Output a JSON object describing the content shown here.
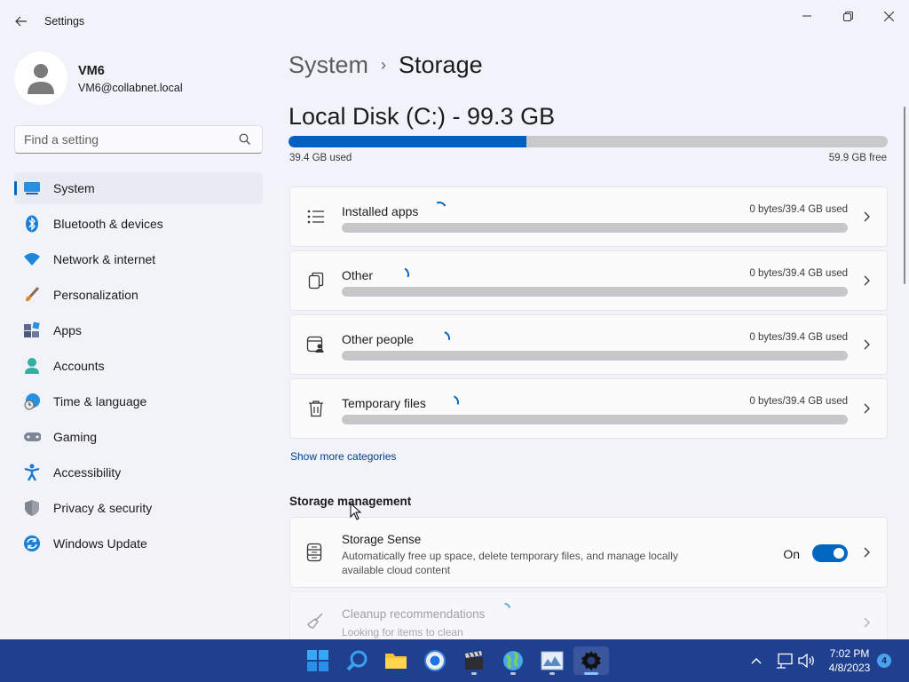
{
  "window": {
    "app_title": "Settings"
  },
  "profile": {
    "name": "VM6",
    "email": "VM6@collabnet.local"
  },
  "search": {
    "placeholder": "Find a setting"
  },
  "sidebar": {
    "items": [
      {
        "label": "System",
        "icon": "system-icon",
        "active": true
      },
      {
        "label": "Bluetooth & devices",
        "icon": "bluetooth-icon"
      },
      {
        "label": "Network & internet",
        "icon": "wifi-icon"
      },
      {
        "label": "Personalization",
        "icon": "brush-icon"
      },
      {
        "label": "Apps",
        "icon": "apps-icon"
      },
      {
        "label": "Accounts",
        "icon": "accounts-icon"
      },
      {
        "label": "Time & language",
        "icon": "globe-clock-icon"
      },
      {
        "label": "Gaming",
        "icon": "gamepad-icon"
      },
      {
        "label": "Accessibility",
        "icon": "accessibility-icon"
      },
      {
        "label": "Privacy & security",
        "icon": "shield-icon"
      },
      {
        "label": "Windows Update",
        "icon": "update-icon"
      }
    ]
  },
  "breadcrumb": {
    "parent": "System",
    "separator": "›",
    "current": "Storage"
  },
  "disk": {
    "title": "Local Disk (C:) - 99.3 GB",
    "used_label": "39.4 GB used",
    "free_label": "59.9 GB free",
    "used_fraction": 0.397
  },
  "categories": [
    {
      "label": "Installed apps",
      "usage": "0 bytes/39.4 GB used",
      "icon": "list-icon"
    },
    {
      "label": "Other",
      "usage": "0 bytes/39.4 GB used",
      "icon": "document-icon"
    },
    {
      "label": "Other people",
      "usage": "0 bytes/39.4 GB used",
      "icon": "people-icon"
    },
    {
      "label": "Temporary files",
      "usage": "0 bytes/39.4 GB used",
      "icon": "trash-icon"
    }
  ],
  "show_more": "Show more categories",
  "storage_management": {
    "title": "Storage management",
    "storage_sense": {
      "title": "Storage Sense",
      "description": "Automatically free up space, delete temporary files, and manage locally available cloud content",
      "toggle_label": "On",
      "toggle_on": true
    },
    "cleanup": {
      "title": "Cleanup recommendations",
      "description": "Looking for items to clean"
    }
  },
  "taskbar": {
    "apps": [
      "start-icon",
      "search-icon",
      "file-explorer-icon",
      "chrome-icon",
      "video-editor-icon",
      "maps-icon",
      "image-viewer-icon",
      "settings-icon"
    ],
    "time": "7:02 PM",
    "date": "4/8/2023",
    "notification_count": "4"
  },
  "colors": {
    "accent": "#0067c0",
    "taskbar": "#1f3f8f"
  }
}
